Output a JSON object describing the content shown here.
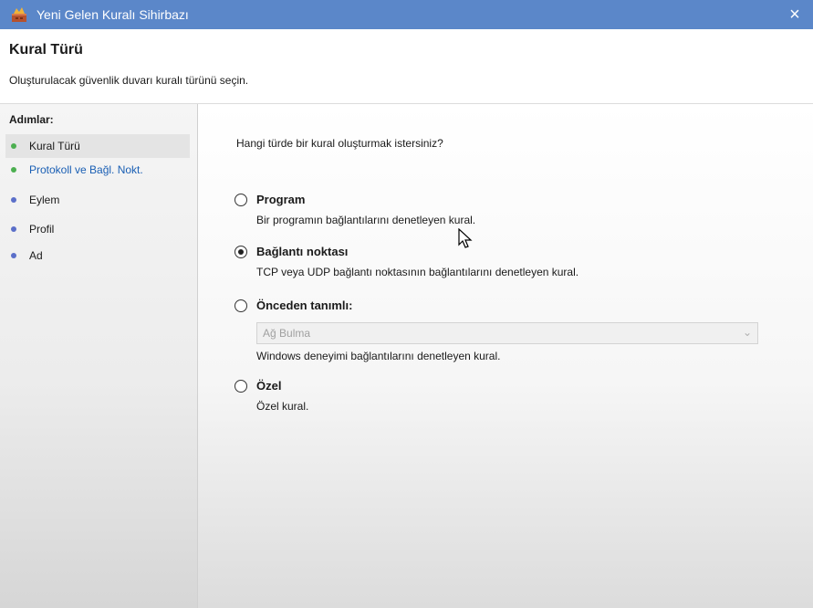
{
  "window": {
    "title": "Yeni Gelen Kuralı Sihirbazı",
    "close_icon": "×"
  },
  "header": {
    "title": "Kural Türü",
    "subtitle": "Oluşturulacak güvenlik duvarı kuralı türünü seçin."
  },
  "sidebar": {
    "title": "Adımlar:",
    "steps": [
      {
        "label": "Kural Türü",
        "dot_color": "#4caf50",
        "active": true
      },
      {
        "label": "Protokoll ve Bağl. Nokt.",
        "dot_color": "#4caf50",
        "link": true
      },
      {
        "label": "Eylem",
        "dot_color": "#5b6fc9"
      },
      {
        "label": "Profil",
        "dot_color": "#5b6fc9"
      },
      {
        "label": "Ad",
        "dot_color": "#5b6fc9"
      }
    ]
  },
  "main": {
    "question": "Hangi türde bir kural oluşturmak istersiniz?",
    "options": [
      {
        "label": "Program",
        "description": "Bir programın bağlantılarını denetleyen kural.",
        "selected": false
      },
      {
        "label": "Bağlantı noktası",
        "description": "TCP veya UDP bağlantı noktasının bağlantılarını denetleyen kural.",
        "selected": true
      },
      {
        "label": "Önceden tanımlı:",
        "description": "Windows deneyimi bağlantılarını denetleyen kural.",
        "selected": false
      },
      {
        "label": "Özel",
        "description": "Özel kural.",
        "selected": false
      }
    ],
    "predefined_select": {
      "value": "Ağ Bulma",
      "icon": "chevron-down-icon"
    }
  },
  "colors": {
    "titlebar": "#5b87c9",
    "step_done": "#4caf50",
    "step_pending": "#5b6fc9"
  }
}
